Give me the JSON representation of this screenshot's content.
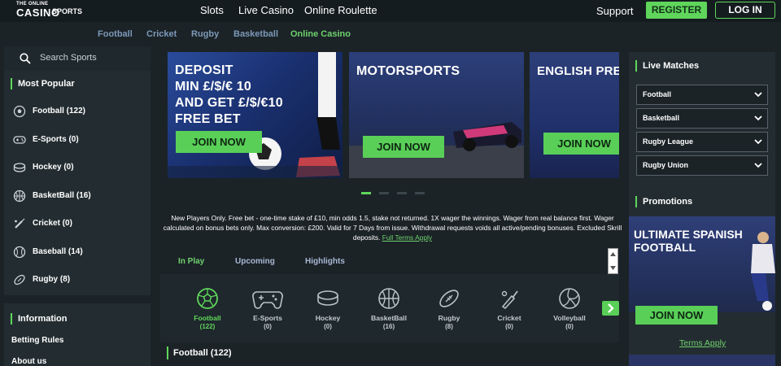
{
  "header": {
    "logo": {
      "line1": "THE ONLINE",
      "line2": "CASINO",
      "line3": "SPORTS"
    },
    "nav": [
      "Slots",
      "Live Casino",
      "Online Roulette"
    ],
    "support_label": "Support",
    "register_label": "REGISTER",
    "login_label": "LOG IN"
  },
  "subnav": {
    "items": [
      "Football",
      "Cricket",
      "Rugby",
      "Basketball",
      "Online Casino"
    ],
    "active": "Online Casino"
  },
  "sidebar": {
    "search_placeholder": "Search Sports",
    "most_popular_heading": "Most Popular",
    "items": [
      {
        "label": "Football (122)",
        "icon": "football-icon"
      },
      {
        "label": "E-Sports (0)",
        "icon": "gamepad-icon"
      },
      {
        "label": "Hockey (0)",
        "icon": "hockey-puck-icon"
      },
      {
        "label": "BasketBall (16)",
        "icon": "basketball-icon"
      },
      {
        "label": "Cricket (0)",
        "icon": "cricket-bat-icon"
      },
      {
        "label": "Baseball (14)",
        "icon": "baseball-icon"
      },
      {
        "label": "Rugby (8)",
        "icon": "rugby-ball-icon"
      }
    ],
    "information_heading": "Information",
    "links": [
      "Betting Rules",
      "About us"
    ]
  },
  "banners": [
    {
      "title": [
        "DEPOSIT",
        "MIN £/$/€ 10",
        "AND GET £/$/€10",
        "FREE BET"
      ],
      "cta": "JOIN NOW"
    },
    {
      "title": [
        "MOTORSPORTS"
      ],
      "cta": "JOIN NOW"
    },
    {
      "title": [
        "ENGLISH PREMI"
      ],
      "cta": "JOIN NOW"
    }
  ],
  "carousel": {
    "dot_count": 4,
    "active_index": 0
  },
  "disclaimer": {
    "text": "New Players Only. Free bet - one-time stake of £10, min odds 1.5, stake not returned. 1X wager the winnings. Wager from real balance first. Wager calculated on bonus bets only. Max conversion: £200. Valid for 7 Days from issue. Withdrawal requests voids all active/pending bonuses. Excluded Skrill deposits.",
    "link": "Full Terms Apply"
  },
  "tabs": {
    "items": [
      "In Play",
      "Upcoming",
      "Highlights"
    ],
    "active": "In Play"
  },
  "sports_row": [
    {
      "name": "Football",
      "count": "(122)",
      "icon": "football-icon",
      "active": true
    },
    {
      "name": "E-Sports",
      "count": "(0)",
      "icon": "gamepad-icon",
      "active": false
    },
    {
      "name": "Hockey",
      "count": "(0)",
      "icon": "hockey-puck-icon",
      "active": false
    },
    {
      "name": "BasketBall",
      "count": "(16)",
      "icon": "basketball-icon",
      "active": false
    },
    {
      "name": "Rugby",
      "count": "(8)",
      "icon": "rugby-ball-icon",
      "active": false
    },
    {
      "name": "Cricket",
      "count": "(0)",
      "icon": "cricket-bat-icon",
      "active": false
    },
    {
      "name": "Volleyball",
      "count": "(0)",
      "icon": "volleyball-icon",
      "active": false
    }
  ],
  "section_heading": "Football  (122)",
  "right": {
    "live_heading": "Live Matches",
    "live_selects": [
      "Football",
      "Basketball",
      "Rugby League",
      "Rugby Union"
    ],
    "promotions_heading": "Promotions",
    "promo_title": [
      "ULTIMATE SPANISH",
      "FOOTBALL"
    ],
    "promo_cta": "JOIN NOW",
    "terms_link": "Terms Apply"
  },
  "colors": {
    "accent": "#5fd65b",
    "background": "#1b2327",
    "panel": "#232d31",
    "subnav_link": "#7d99b8"
  }
}
